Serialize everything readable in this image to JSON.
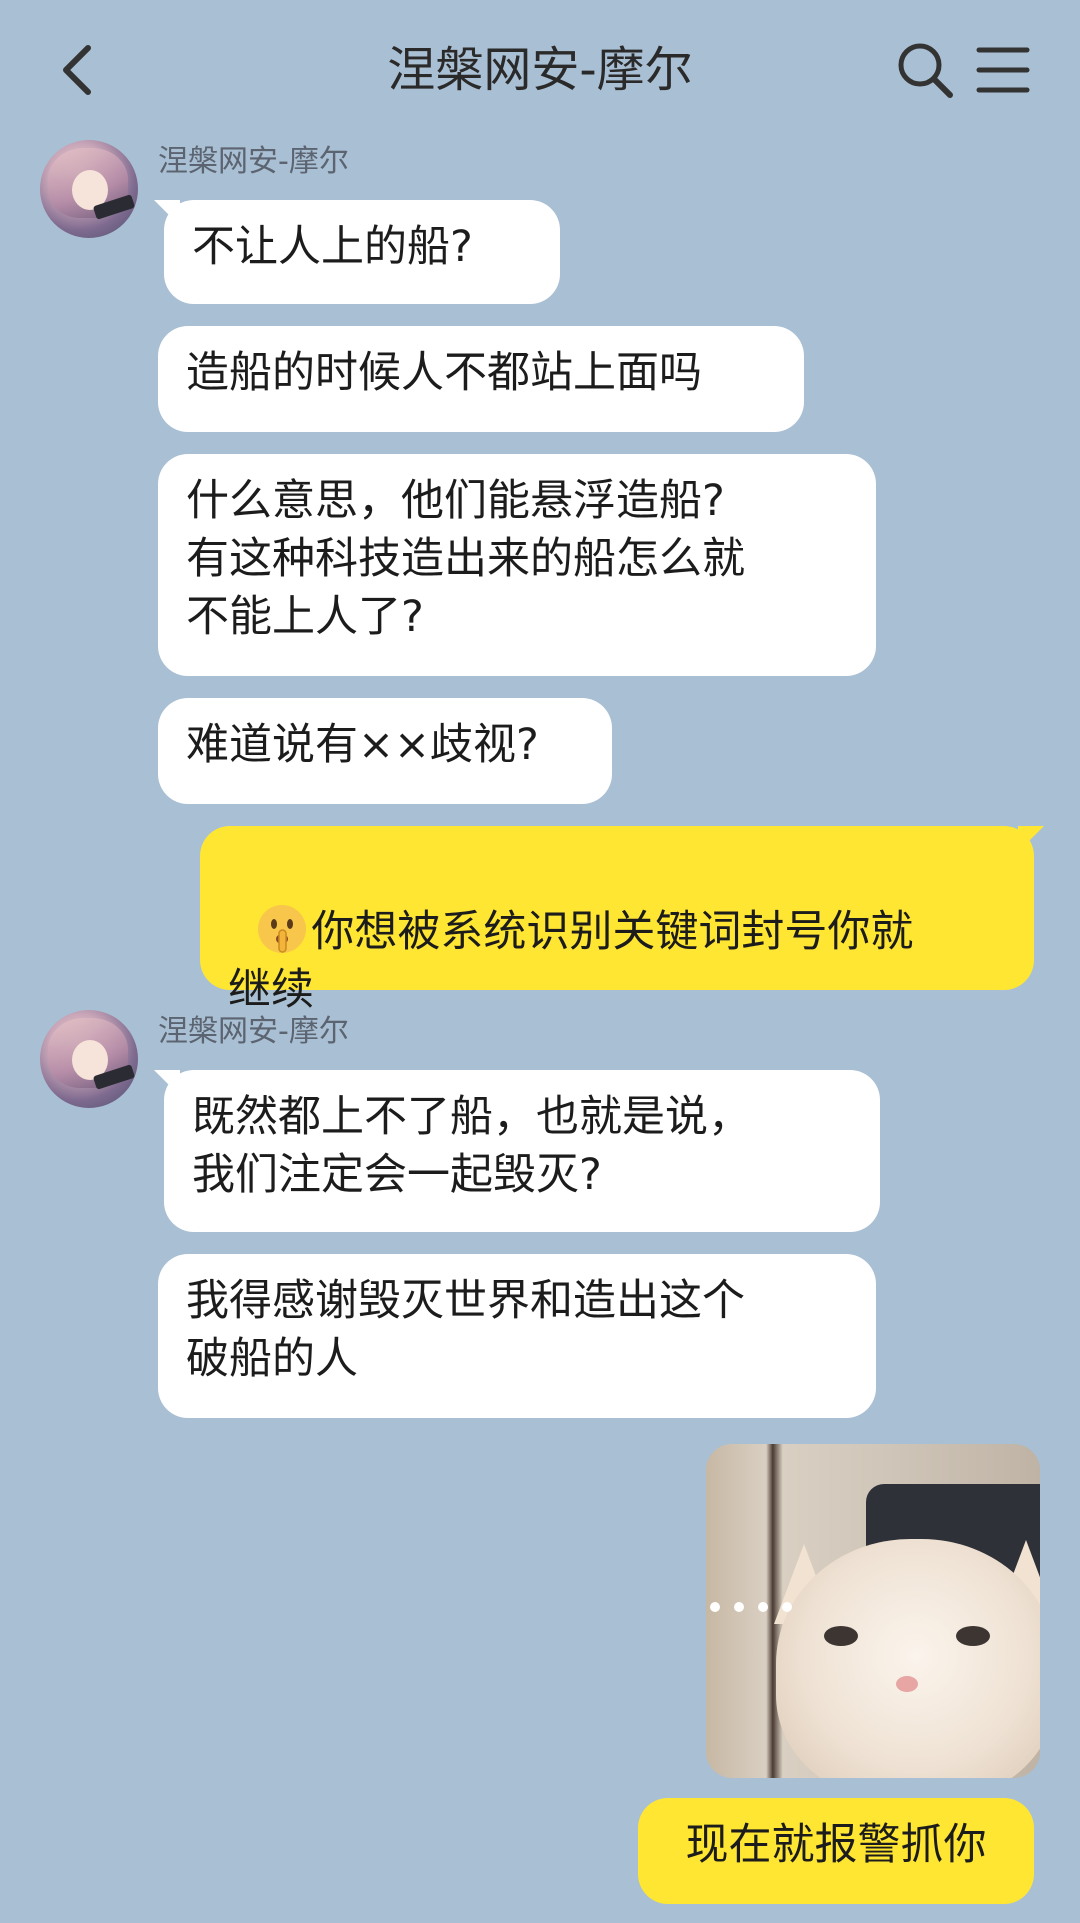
{
  "header": {
    "title": "涅槃网安-摩尔",
    "back_icon": "chevron-left-icon",
    "search_icon": "search-icon",
    "menu_icon": "menu-icon"
  },
  "messages": [
    {
      "sender": "涅槃网安-摩尔",
      "avatar_icon": "contact-avatar",
      "bubbles": [
        "不让人上的船?",
        "造船的时候人不都站上面吗",
        "什么意思，他们能悬浮造船?\n有这种科技造出来的船怎么就\n不能上人了?",
        "难道说有××歧视?"
      ]
    },
    {
      "sender_is_me": true,
      "emoji_icon": "shushing-face-emoji",
      "text": "你想被系统识别关键词封号你就\n继续"
    },
    {
      "sender": "涅槃网安-摩尔",
      "avatar_icon": "contact-avatar",
      "bubbles": [
        "既然都上不了船，也就是说，\n我们注定会一起毁灭?",
        "我得感谢毁灭世界和造出这个\n破船的人"
      ]
    },
    {
      "sender_is_me": true,
      "image": "cat-photo"
    },
    {
      "sender_is_me": true,
      "text": "现在就报警抓你"
    }
  ],
  "colors": {
    "background": "#a9bfd3",
    "incoming_bubble": "#ffffff",
    "outgoing_bubble": "#ffe633",
    "text": "#1c1c1c",
    "sender_name": "#5b6470"
  }
}
